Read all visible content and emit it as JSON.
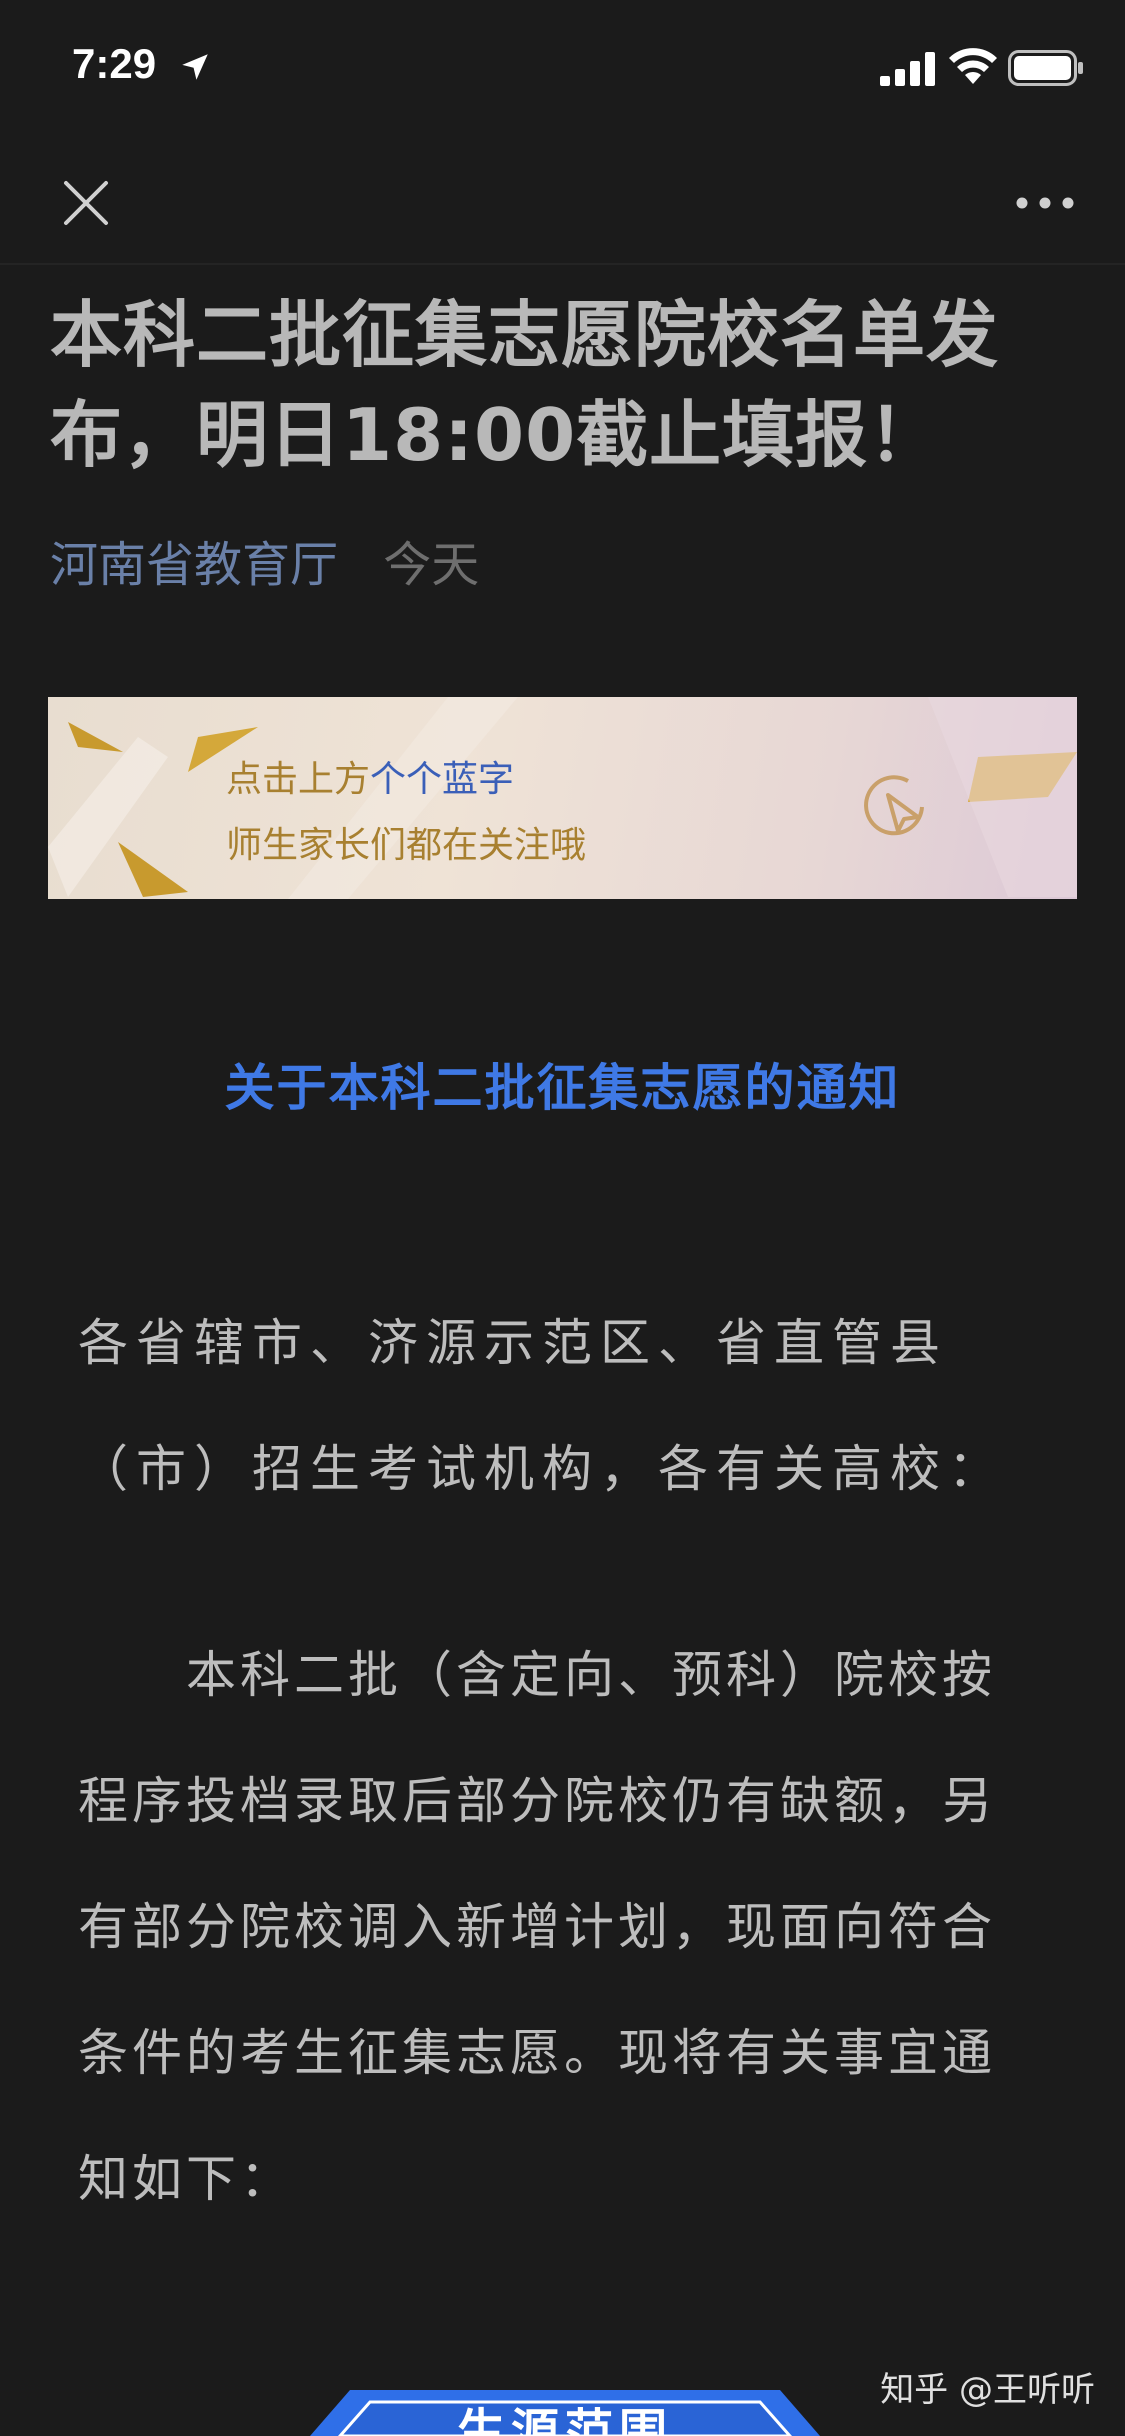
{
  "status_bar": {
    "time": "7:29"
  },
  "article": {
    "title": "本科二批征集志愿院校名单发布，明日18:00截止填报！",
    "author": "河南省教育厅",
    "date": "今天"
  },
  "banner": {
    "line1_prefix": "点击上方",
    "line1_highlight": "个个蓝字",
    "line2": "师生家长们都在关注哦"
  },
  "notice": {
    "title": "关于本科二批征集志愿的通知",
    "para1": "各省辖市、济源示范区、省直管县（市）招生考试机构，各有关高校：",
    "para2": "本科二批（含定向、预科）院校按程序投档录取后部分院校仍有缺额，另有部分院校调入新增计划，现面向符合条件的考生征集志愿。现将有关事宜通知如下："
  },
  "section": {
    "label": "生源范围"
  },
  "watermark": "知乎 @王听听",
  "colors": {
    "background": "#1b1b1b",
    "link_blue": "#3f79e6",
    "author_blue": "#6a80a8",
    "banner_gold": "#a88030"
  },
  "icons": [
    "location-arrow-icon",
    "signal-icon",
    "wifi-icon",
    "battery-icon",
    "close-icon",
    "more-icon",
    "cursor-icon"
  ]
}
